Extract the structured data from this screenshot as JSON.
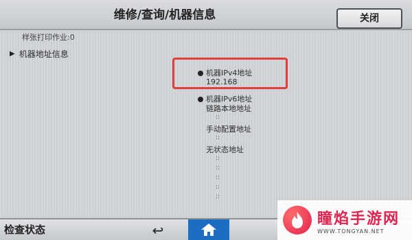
{
  "header": {
    "title": "维修/查询/机器信息",
    "close_label": "关闭"
  },
  "content": {
    "prev_item": "样张打印作业:0",
    "section_title": "机器地址信息",
    "ipv4": {
      "label": "机器IPv4地址",
      "value": "192.168"
    },
    "ipv6": {
      "label": "机器IPv6地址",
      "link_local_label": "链路本地地址",
      "manual_label": "手动配置地址",
      "stateless_label": "无状态地址",
      "colon": "::"
    }
  },
  "footer": {
    "status_label": "检查状态"
  },
  "icons": {
    "back": "back-arrow-icon",
    "home": "home-icon",
    "section": "triangle-right-icon"
  },
  "colors": {
    "highlight": "#e23d3d",
    "home_button": "#1e6dc4"
  },
  "watermark": {
    "title": "瞳焰手游网",
    "url": "WWW.TONGYAN.NET"
  }
}
